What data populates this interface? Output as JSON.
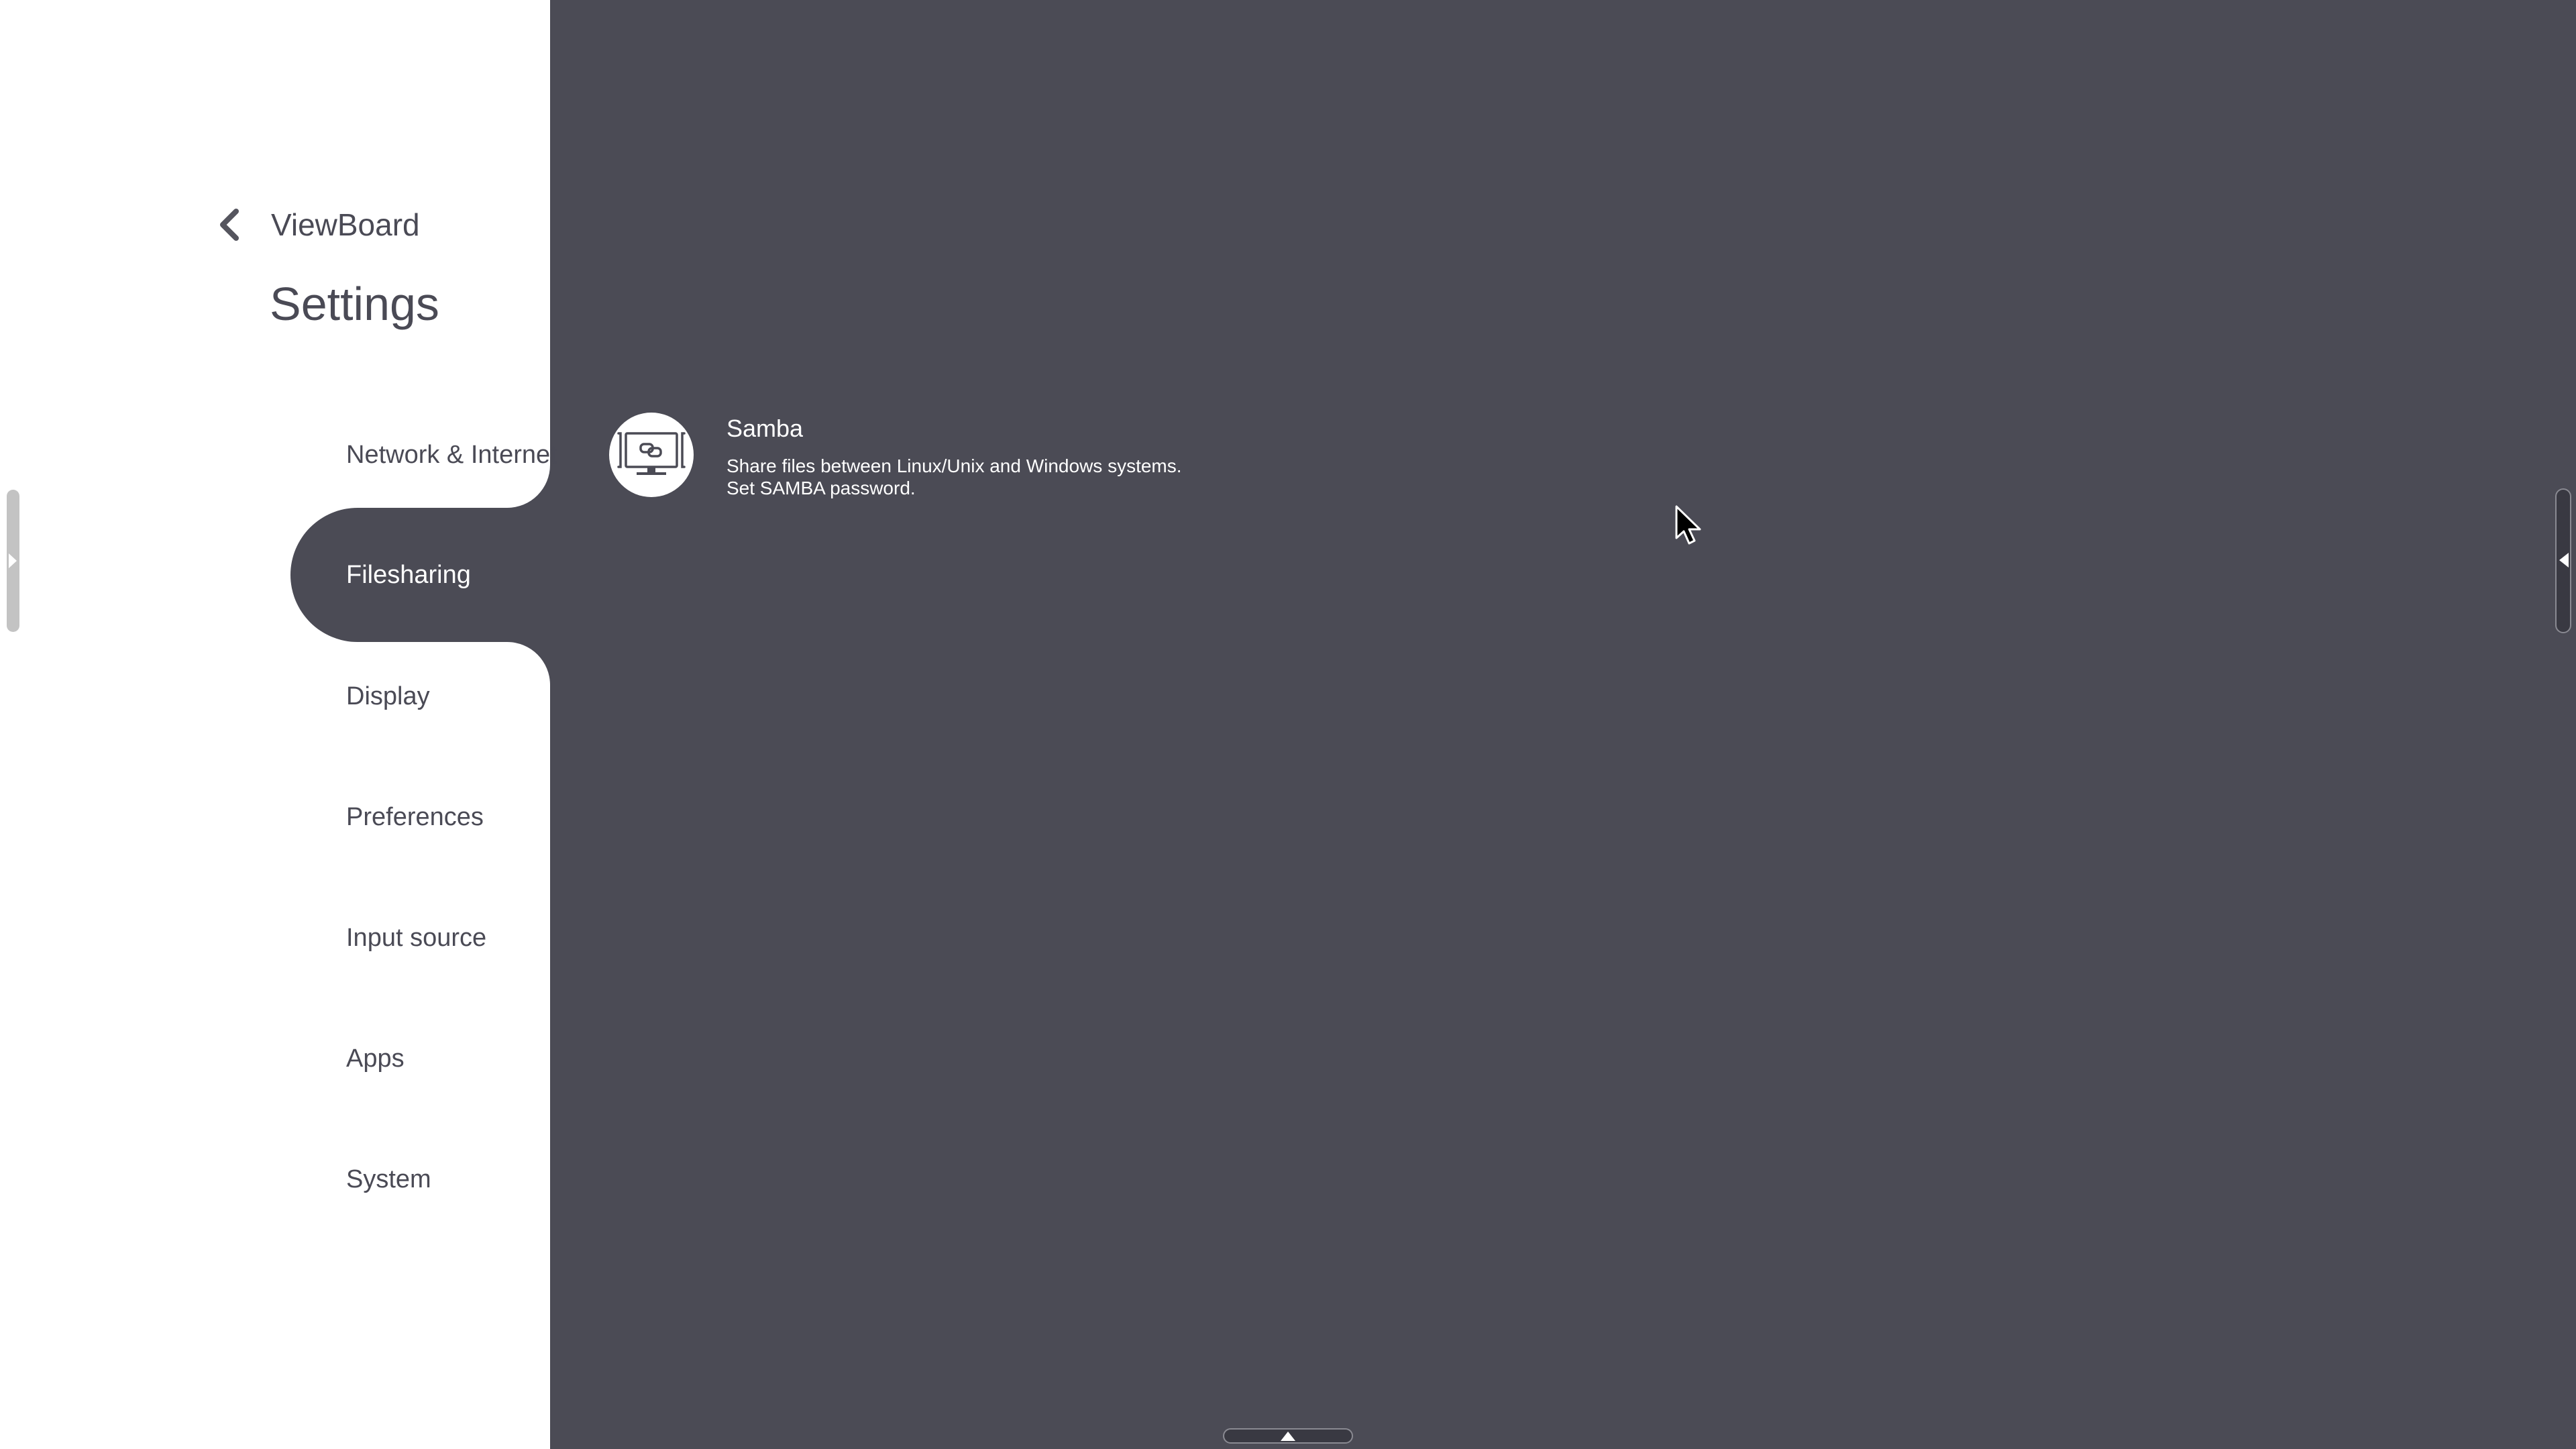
{
  "header": {
    "back_label": "ViewBoard",
    "page_title": "Settings"
  },
  "sidebar": {
    "items": [
      {
        "label": "Network & Internet",
        "active": false
      },
      {
        "label": "Filesharing",
        "active": true
      },
      {
        "label": "Display",
        "active": false
      },
      {
        "label": "Preferences",
        "active": false
      },
      {
        "label": "Input source",
        "active": false
      },
      {
        "label": "Apps",
        "active": false
      },
      {
        "label": "System",
        "active": false
      }
    ]
  },
  "content": {
    "items": [
      {
        "icon": "samba-monitor-link-icon",
        "title": "Samba",
        "description_lines": [
          "Share files between Linux/Unix and Windows systems.",
          "Set SAMBA password."
        ]
      }
    ]
  },
  "colors": {
    "sidebar_bg": "#ffffff",
    "content_bg": "#4b4b55",
    "text_dark": "#4a4a55",
    "text_light": "#ffffff"
  }
}
